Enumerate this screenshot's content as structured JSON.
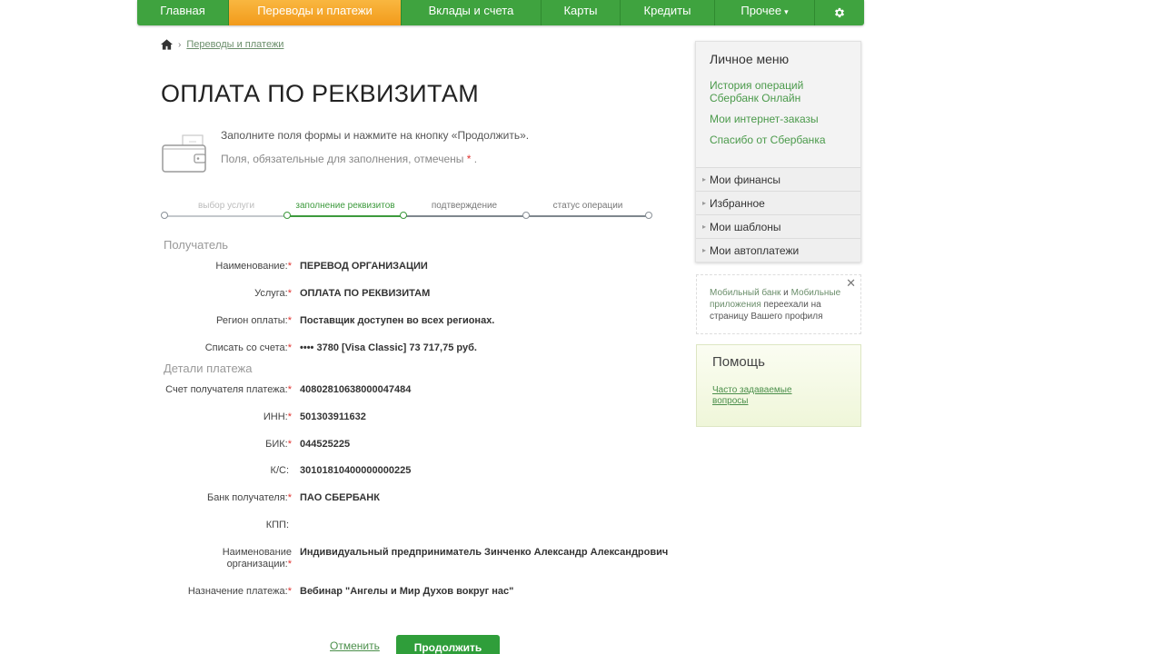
{
  "nav": {
    "items": [
      {
        "label": "Главная"
      },
      {
        "label": "Переводы и платежи"
      },
      {
        "label": "Вклады и счета"
      },
      {
        "label": "Карты"
      },
      {
        "label": "Кредиты"
      },
      {
        "label": "Прочее"
      }
    ]
  },
  "breadcrumb": {
    "current": "Переводы и платежи"
  },
  "page": {
    "title": "ОПЛАТА ПО РЕКВИЗИТАМ",
    "hint1": "Заполните поля формы и нажмите на кнопку «Продолжить».",
    "hint2": "Поля, обязательные для заполнения, отмечены",
    "required_mark": "*",
    "hint2_end": "."
  },
  "steps": [
    {
      "label": "выбор услуги",
      "state": "done"
    },
    {
      "label": "заполнение реквизитов",
      "state": "current"
    },
    {
      "label": "подтверждение",
      "state": "todo"
    },
    {
      "label": "статус операции",
      "state": "todo"
    }
  ],
  "sections": {
    "recipient": "Получатель",
    "details": "Детали платежа"
  },
  "recipient_rows": [
    {
      "label": "Наименование:",
      "required": true,
      "value": "ПЕРЕВОД ОРГАНИЗАЦИИ"
    },
    {
      "label": "Услуга:",
      "required": true,
      "value": "ОПЛАТА ПО РЕКВИЗИТАМ"
    },
    {
      "label": "Регион оплаты:",
      "required": true,
      "value": "Поставщик доступен во всех регионах."
    },
    {
      "label": "Списать со счета:",
      "required": true,
      "value": "•••• 3780  [Visa Classic] 73 717,75   руб."
    }
  ],
  "detail_rows": [
    {
      "label": "Счет получателя платежа:",
      "required": true,
      "value": "40802810638000047484"
    },
    {
      "label": "ИНН:",
      "required": true,
      "value": "501303911632"
    },
    {
      "label": "БИК:",
      "required": true,
      "value": "044525225"
    },
    {
      "label": "К/С:",
      "required": false,
      "value": "30101810400000000225"
    },
    {
      "label": "Банк получателя:",
      "required": true,
      "value": "ПАО СБЕРБАНК"
    },
    {
      "label": "КПП:",
      "required": false,
      "value": ""
    },
    {
      "label": "Наименование\nорганизации:",
      "required": true,
      "value": "Индивидуальный предприниматель Зинченко Александр Александрович"
    },
    {
      "label": "Назначение платежа:",
      "required": true,
      "value": "Вебинар \"Ангелы и Мир Духов вокруг нас\""
    }
  ],
  "actions": {
    "cancel": "Отменить",
    "continue": "Продолжить"
  },
  "sidebar": {
    "title": "Личное меню",
    "links": [
      "История операций Сбербанк Онлайн",
      "Мои интернет-заказы",
      "Спасибо от Сбербанка"
    ],
    "items": [
      "Мои финансы",
      "Избранное",
      "Мои шаблоны",
      "Мои автоплатежи"
    ]
  },
  "notice": {
    "link1": "Мобильный банк",
    "and": " и ",
    "link2": "Мобильные приложения",
    "rest": " переехали на страницу Вашего профиля"
  },
  "help": {
    "title": "Помощь",
    "link": "Часто задаваемые вопросы"
  },
  "colors": {
    "brand_green": "#3fa33f",
    "active_orange": "#f29a1b",
    "required_red": "#e0322f"
  }
}
